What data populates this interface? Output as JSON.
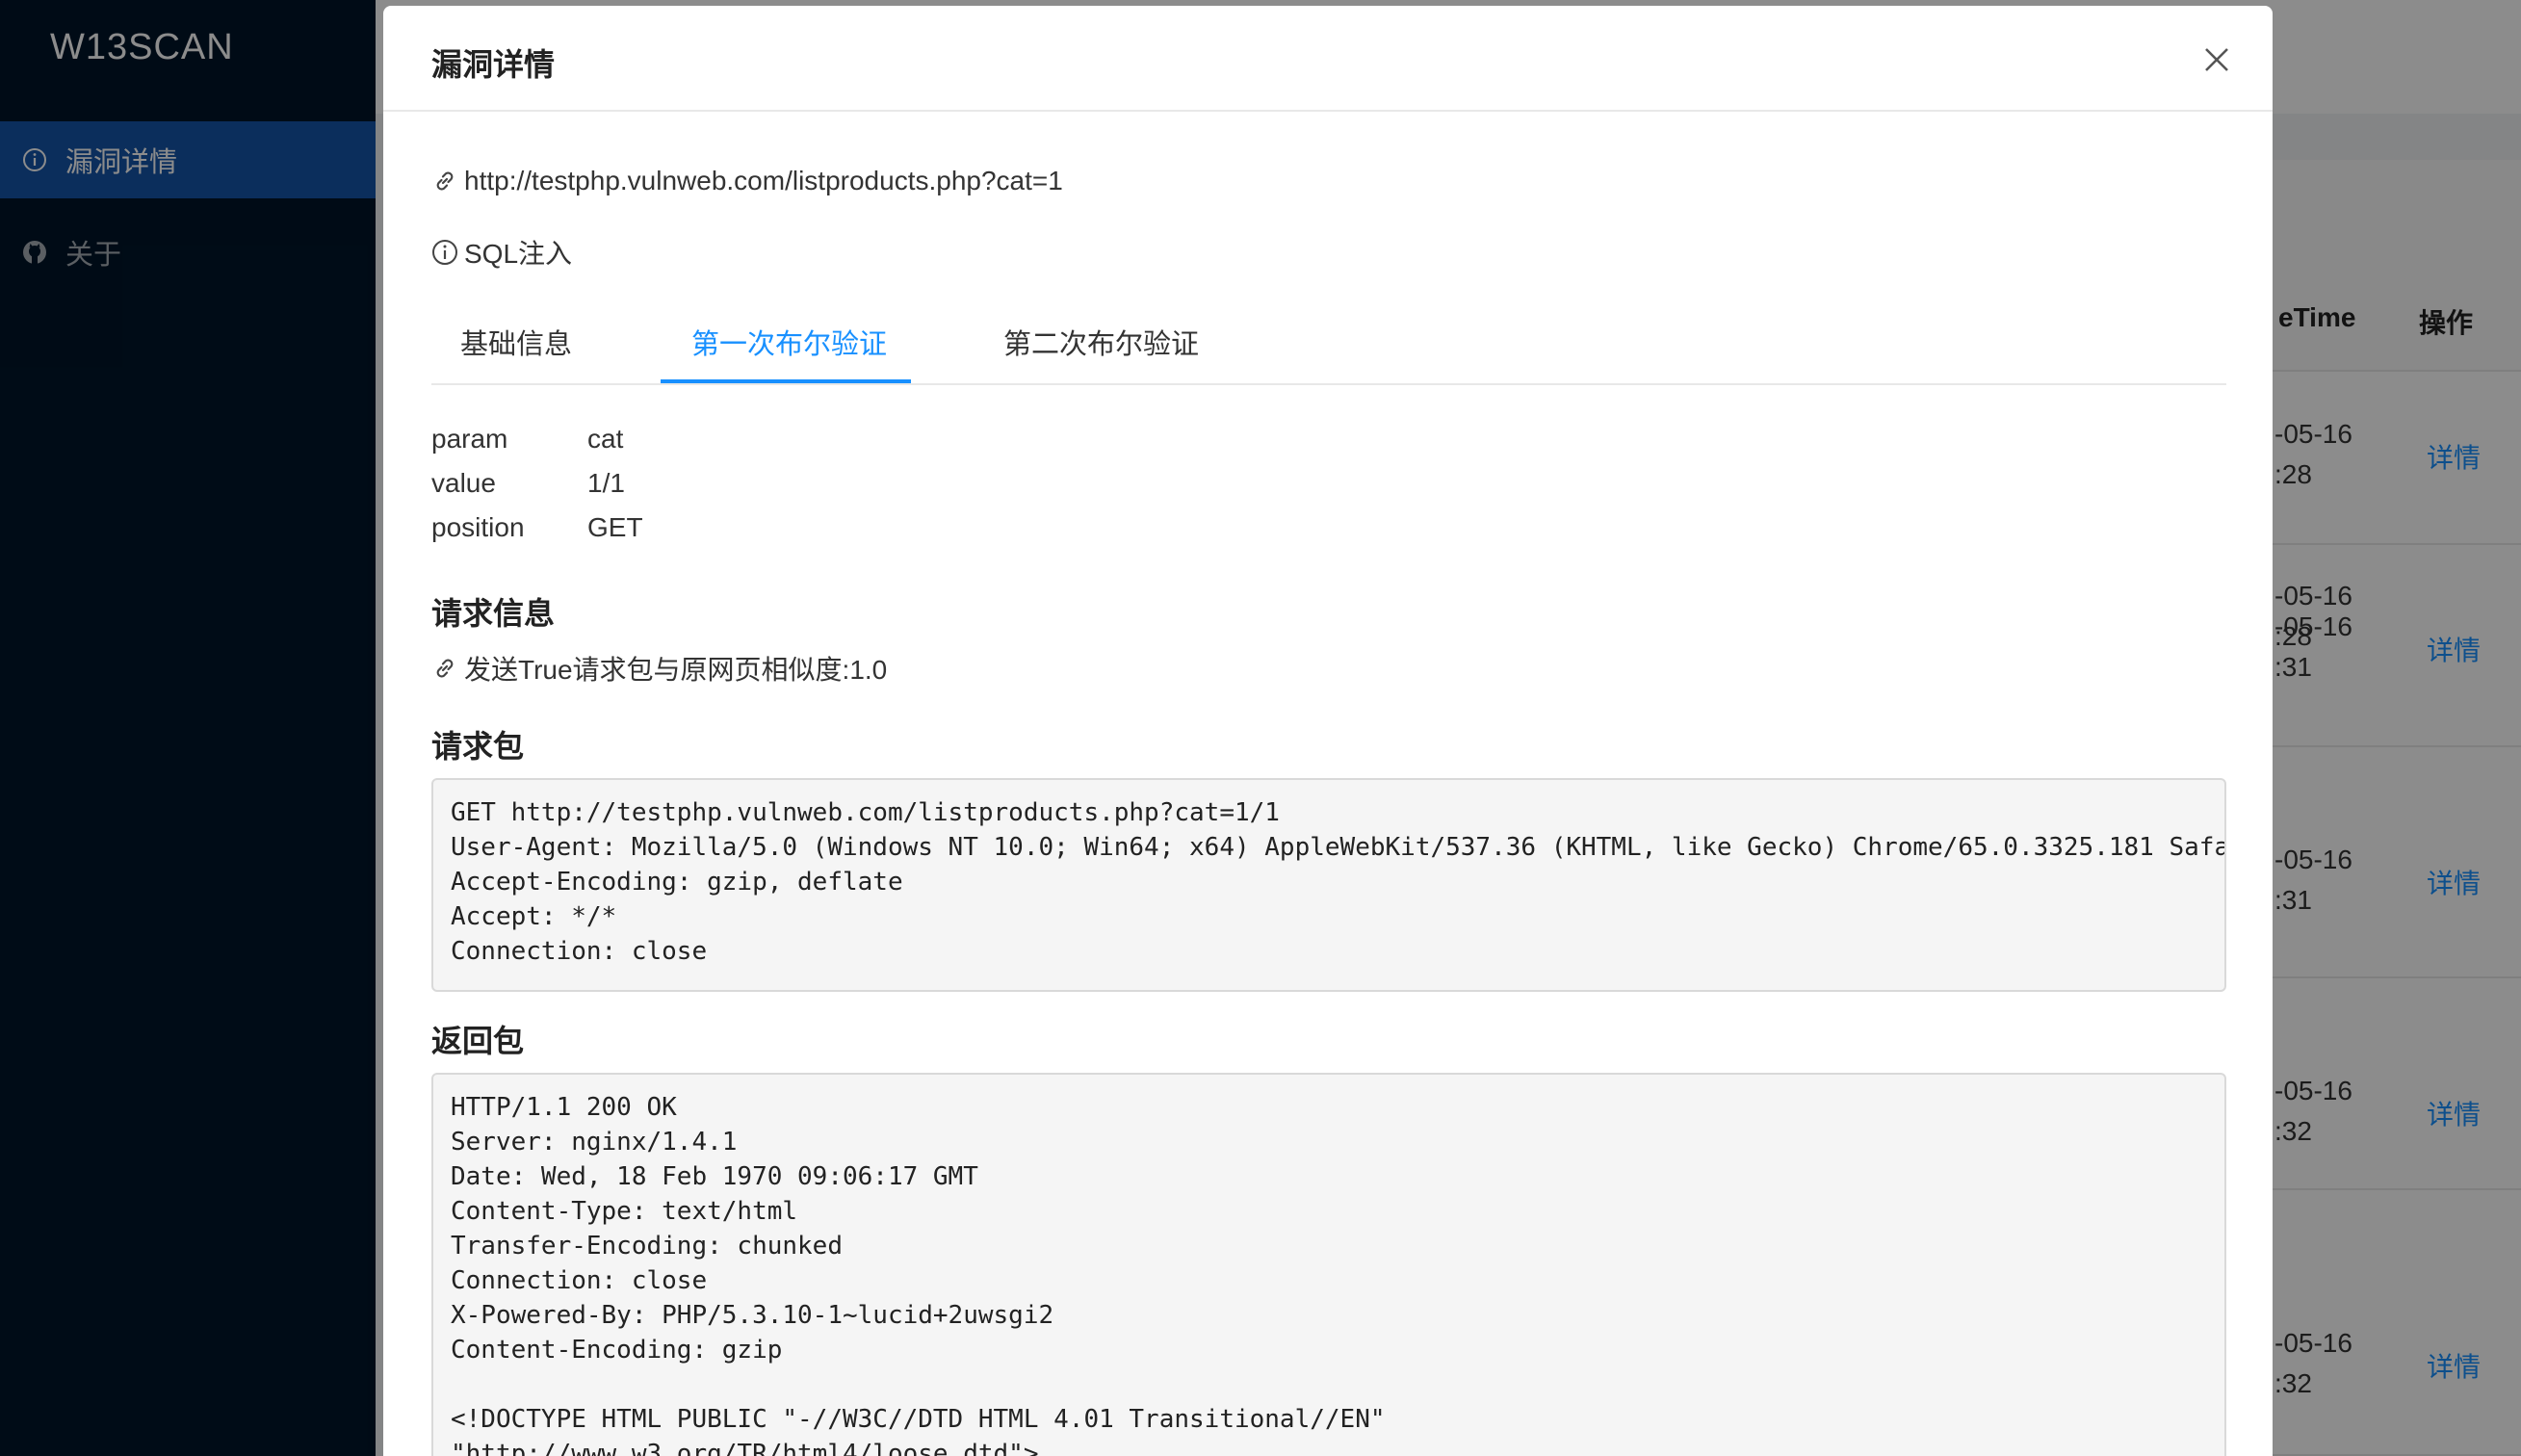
{
  "app": {
    "logo": "W13SCAN"
  },
  "sidebar": {
    "items": [
      {
        "label": "漏洞详情",
        "icon": "info-circle-icon",
        "active": true
      },
      {
        "label": "关于",
        "icon": "github-icon",
        "active": false
      }
    ]
  },
  "background_table": {
    "columns": [
      "eTime",
      "操作"
    ],
    "rows": [
      {
        "time": "-05-16\n:28",
        "action": "详情"
      },
      {
        "time": "-05-16\n:31",
        "action": "详情"
      },
      {
        "time": "-05-16\n:31",
        "action": "详情"
      },
      {
        "time": "-05-16\n:32",
        "action": "详情"
      },
      {
        "time": "-05-16\n:32",
        "action": "详情"
      }
    ]
  },
  "modal": {
    "title": "漏洞详情",
    "url": "http://testphp.vulnweb.com/listproducts.php?cat=1",
    "vuln_type": "SQL注入",
    "tabs": [
      "基础信息",
      "第一次布尔验证",
      "第二次布尔验证"
    ],
    "active_tab": 1,
    "details": [
      {
        "key": "param",
        "value": "cat"
      },
      {
        "key": "value",
        "value": "1/1"
      },
      {
        "key": "position",
        "value": "GET"
      }
    ],
    "request_info_heading": "请求信息",
    "similarity_text": "发送True请求包与原网页相似度:1.0",
    "request_heading": "请求包",
    "request_packet": "GET http://testphp.vulnweb.com/listproducts.php?cat=1/1\nUser-Agent: Mozilla/5.0 (Windows NT 10.0; Win64; x64) AppleWebKit/537.36 (KHTML, like Gecko) Chrome/65.0.3325.181 Safa\nAccept-Encoding: gzip, deflate\nAccept: */*\nConnection: close",
    "response_heading": "返回包",
    "response_packet": "HTTP/1.1 200 OK\nServer: nginx/1.4.1\nDate: Wed, 18 Feb 1970 09:06:17 GMT\nContent-Type: text/html\nTransfer-Encoding: chunked\nConnection: close\nX-Powered-By: PHP/5.3.10-1~lucid+2uwsgi2\nContent-Encoding: gzip\n\n<!DOCTYPE HTML PUBLIC \"-//W3C//DTD HTML 4.01 Transitional//EN\"\n\"http://www.w3.org/TR/html4/loose.dtd\">"
  },
  "colors": {
    "accent": "#1890ff",
    "sider_bg": "#001529",
    "menu_active": "#1554a8"
  }
}
